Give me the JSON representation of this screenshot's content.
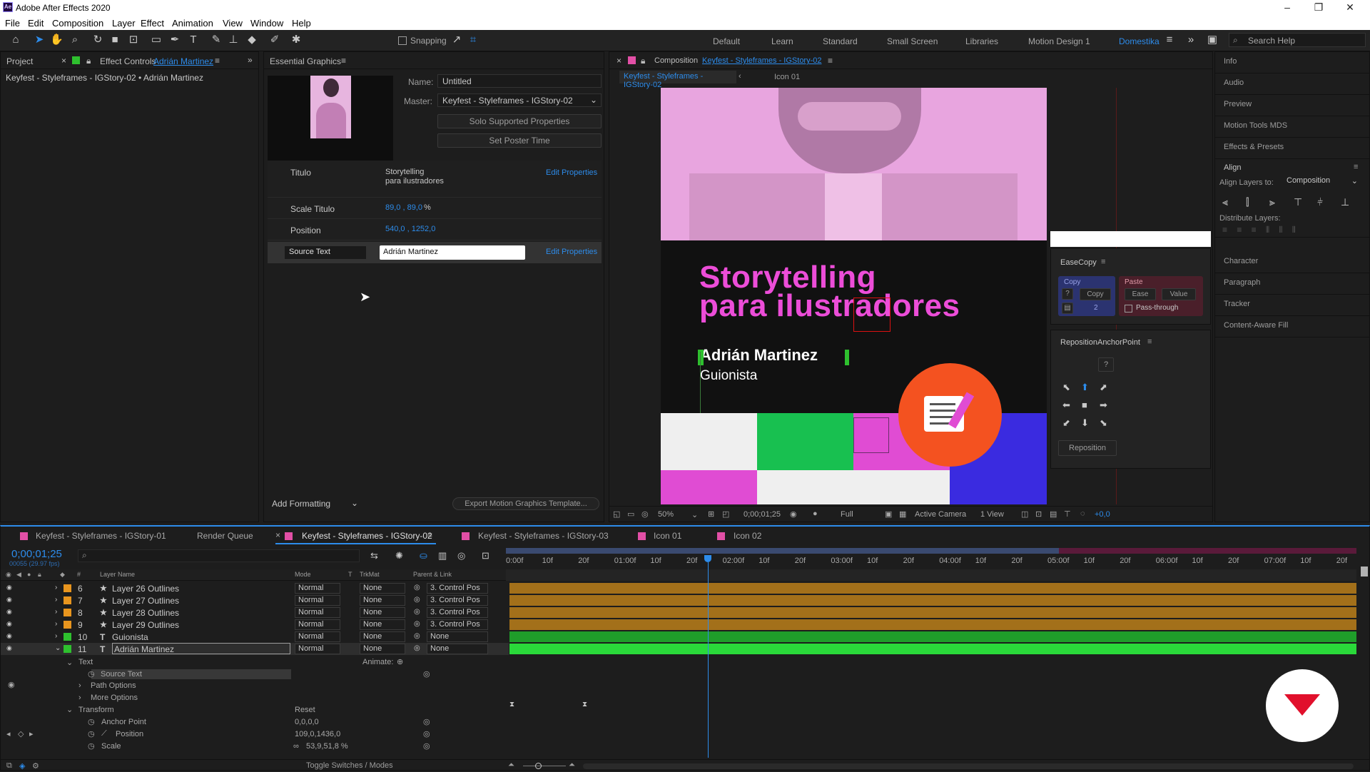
{
  "window": {
    "title": "Adobe After Effects 2020"
  },
  "menu": [
    "File",
    "Edit",
    "Composition",
    "Layer",
    "Effect",
    "Animation",
    "View",
    "Window",
    "Help"
  ],
  "toolbar": {
    "snapping": "Snapping"
  },
  "workspaces": [
    "Default",
    "Learn",
    "Standard",
    "Small Screen",
    "Libraries",
    "Motion Design 1",
    "Domestika"
  ],
  "search_help": "Search Help",
  "left_panel": {
    "tab_project": "Project",
    "tab_effect_controls": "Effect Controls",
    "effect_controls_layer": "Adrián Martinez",
    "breadcrumb": "Keyfest - Styleframes - IGStory-02 • Adrián Martinez"
  },
  "essential_graphics": {
    "title": "Essential Graphics",
    "name_label": "Name:",
    "name_value": "Untitled",
    "master_label": "Master:",
    "master_value": "Keyfest - Styleframes - IGStory-02",
    "solo_button": "Solo Supported Properties",
    "poster_button": "Set Poster Time",
    "props": [
      {
        "label": "Titulo",
        "value1": "Storytelling",
        "value2": "para ilustradores",
        "action": "Edit Properties"
      },
      {
        "label": "Scale Titulo",
        "value": "89,0 , 89,0",
        "unit": "%"
      },
      {
        "label": "Position",
        "value": "540,0 , 1252,0"
      },
      {
        "label": "Source Text",
        "value": "Adrián Martinez",
        "action": "Edit Properties"
      }
    ],
    "add_formatting": "Add Formatting",
    "export_button": "Export Motion Graphics Template..."
  },
  "composition": {
    "tab_label": "Composition",
    "tab_name": "Keyfest - Styleframes - IGStory-02",
    "crumb1": "Keyfest - Styleframes - IGStory-02",
    "crumb2": "Icon 01",
    "title_line1": "Storytelling",
    "title_line2": "para ilustradores",
    "name": "Adrián Martinez",
    "role": "Guionista",
    "zoom": "50%",
    "timecode": "0;00;01;25",
    "resolution": "Full",
    "camera": "Active Camera",
    "views": "1 View",
    "exposure": "+0,0"
  },
  "easecopy": {
    "title": "EaseCopy",
    "copy_label": "Copy",
    "paste_label": "Paste",
    "copy_btn": "Copy",
    "ease_btn": "Ease",
    "value_btn": "Value",
    "q": "?",
    "count": "2",
    "passthrough": "Pass-through"
  },
  "reposition": {
    "title": "RepositionAnchorPoint",
    "q": "?",
    "button": "Reposition"
  },
  "right_panels": [
    "Info",
    "Audio",
    "Preview",
    "Motion Tools MDS",
    "Effects & Presets"
  ],
  "align": {
    "title": "Align",
    "layers_to_label": "Align Layers to:",
    "layers_to_value": "Composition",
    "distribute": "Distribute Layers:"
  },
  "right_panels2": [
    "Character",
    "Paragraph",
    "Tracker",
    "Content-Aware Fill"
  ],
  "timeline": {
    "tabs": [
      "Keyfest - Styleframes - IGStory-01",
      "Render Queue",
      "Keyfest - Styleframes - IGStory-02",
      "Keyfest - Styleframes - IGStory-03",
      "Icon 01",
      "Icon 02"
    ],
    "timecode": "0;00;01;25",
    "fps": "00055 (29.97 fps)",
    "col_layer_name": "Layer Name",
    "col_mode": "Mode",
    "col_t": "T",
    "col_trkmat": "TrkMat",
    "col_parent": "Parent & Link",
    "layers": [
      {
        "num": "6",
        "name": "Layer 26 Outlines",
        "mode": "Normal",
        "trk": "None",
        "parent": "3. Control Pos",
        "color": "#e8951e",
        "bar": "#a3701a"
      },
      {
        "num": "7",
        "name": "Layer 27 Outlines",
        "mode": "Normal",
        "trk": "None",
        "parent": "3. Control Pos",
        "color": "#e8951e",
        "bar": "#a3701a"
      },
      {
        "num": "8",
        "name": "Layer 28 Outlines",
        "mode": "Normal",
        "trk": "None",
        "parent": "3. Control Pos",
        "color": "#e8951e",
        "bar": "#a3701a"
      },
      {
        "num": "9",
        "name": "Layer 29 Outlines",
        "mode": "Normal",
        "trk": "None",
        "parent": "3. Control Pos",
        "color": "#e8951e",
        "bar": "#a3701a"
      },
      {
        "num": "10",
        "name": "Guionista",
        "mode": "Normal",
        "trk": "None",
        "parent": "None",
        "color": "#2ec02e",
        "bar": "#1f9d2a"
      },
      {
        "num": "11",
        "name": "Adrián Martinez",
        "mode": "Normal",
        "trk": "None",
        "parent": "None",
        "color": "#2ec02e",
        "bar": "#2ad93a"
      }
    ],
    "props": {
      "text": "Text",
      "animate": "Animate:",
      "source_text": "Source Text",
      "path_options": "Path Options",
      "more_options": "More Options",
      "transform": "Transform",
      "reset": "Reset",
      "anchor_point": "Anchor Point",
      "anchor_value": "0,0,0,0",
      "position": "Position",
      "position_value": "109,0,1436,0",
      "scale": "Scale",
      "scale_value": "53,9,51,8 %"
    },
    "ruler": [
      "0:00f",
      "10f",
      "20f",
      "01:00f",
      "10f",
      "20f",
      "02:00f",
      "10f",
      "20f",
      "03:00f",
      "10f",
      "20f",
      "04:00f",
      "10f",
      "20f",
      "05:00f",
      "10f",
      "20f",
      "06:00f",
      "10f",
      "20f",
      "07:00f",
      "10f",
      "20f"
    ],
    "toggle": "Toggle Switches / Modes"
  }
}
